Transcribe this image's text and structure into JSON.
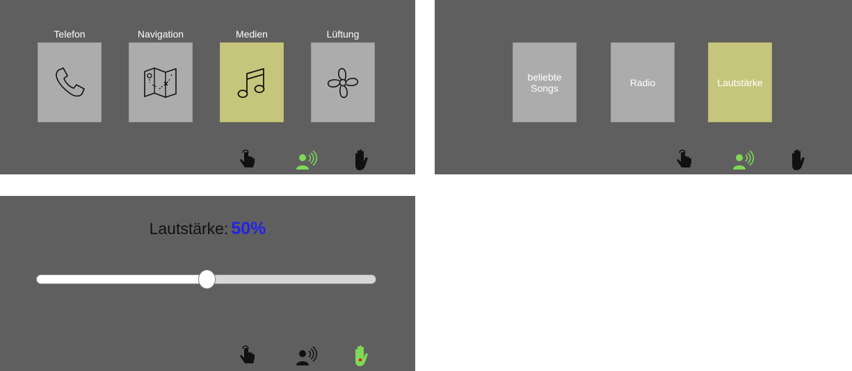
{
  "main_menu": {
    "items": [
      {
        "label": "Telefon",
        "icon": "phone-icon",
        "active": false
      },
      {
        "label": "Navigation",
        "icon": "map-icon",
        "active": false
      },
      {
        "label": "Medien",
        "icon": "music-note-icon",
        "active": true
      },
      {
        "label": "Lüftung",
        "icon": "fan-icon",
        "active": false
      }
    ]
  },
  "media_menu": {
    "items": [
      {
        "label": "beliebte Songs",
        "active": false
      },
      {
        "label": "Radio",
        "active": false
      },
      {
        "label": "Lautstärke",
        "active": true
      }
    ]
  },
  "volume": {
    "label": "Lautstärke:",
    "value_text": "50%",
    "value": 0.5
  },
  "interaction_modes": {
    "icons": [
      "touch-icon",
      "voice-icon",
      "gesture-hand-icon"
    ],
    "panel_main_active": "voice",
    "panel_media_active": "voice",
    "panel_volume_active": "gesture"
  },
  "colors": {
    "panel_bg": "#5f5f5f",
    "tile_bg": "#acacac",
    "tile_active": "#c5c67b",
    "mode_active": "#7ed957",
    "volume_value": "#2323e6"
  }
}
